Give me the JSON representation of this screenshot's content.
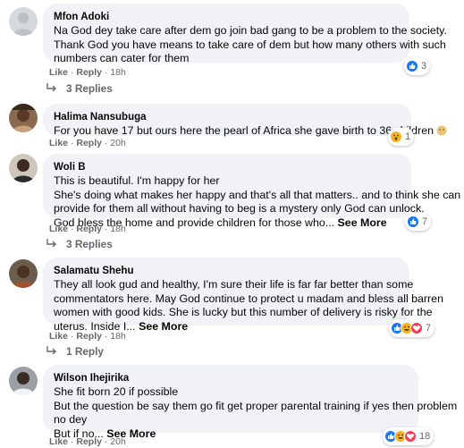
{
  "comments": [
    {
      "author": "Mfon Adoki",
      "lines": [
        "Na God dey take care after dem go join bad gang to be a problem to the society.",
        "Thank God you have means to take care of dem but how many others with such",
        "numbers can cater for them"
      ],
      "see_more": "",
      "like_label": "Like",
      "reply_label": "Reply",
      "time": "18h",
      "reaction_count": "3",
      "reactions": [
        "like"
      ],
      "replies_label": "3 Replies"
    },
    {
      "author": "Halima Nansubuga",
      "lines": [
        "For you have 17 but ours here the pearl of Africa she gave birth to 36 children"
      ],
      "see_more": "",
      "like_label": "Like",
      "reply_label": "Reply",
      "time": "20h",
      "reaction_count": "1",
      "reactions": [
        "wow"
      ],
      "replies_label": ""
    },
    {
      "author": "Woli B",
      "lines": [
        "This is beautiful. I'm happy for her",
        "She's doing what makes her happy and that's all that matters.. and to think she can",
        "provide for them all without having to beg is a mystery only God can unlock.",
        "God bless the home and provide children for those who..."
      ],
      "see_more": "See More",
      "like_label": "Like",
      "reply_label": "Reply",
      "time": "18h",
      "reaction_count": "7",
      "reactions": [
        "like"
      ],
      "replies_label": "3 Replies"
    },
    {
      "author": "Salamatu Shehu",
      "lines": [
        "They all look gud and healthy, I'm sure their life is far far better than some",
        "commentators here. May God continue to protect u madam and bless all barren",
        "women with good kids. She is lucky but this number of delivery is risky for the",
        "uterus. Inside I..."
      ],
      "see_more": "See More",
      "like_label": "Like",
      "reply_label": "Reply",
      "time": "18h",
      "reaction_count": "7",
      "reactions": [
        "like",
        "haha",
        "love"
      ],
      "replies_label": "1 Reply"
    },
    {
      "author": "Wilson Ihejirika",
      "lines": [
        "She fit born 20 if possible",
        "But the question be say them go fit get proper parental training if yes then problem",
        "no dey",
        "But if no..."
      ],
      "see_more": "See More",
      "like_label": "Like",
      "reply_label": "Reply",
      "time": "20h",
      "reaction_count": "18",
      "reactions": [
        "like",
        "haha",
        "love"
      ],
      "replies_label": ""
    }
  ],
  "colors": {
    "bubble": "#f0f2f5",
    "meta": "#65676b",
    "like": "#1877f2",
    "love": "#f33e58",
    "wow": "#f7b125"
  }
}
